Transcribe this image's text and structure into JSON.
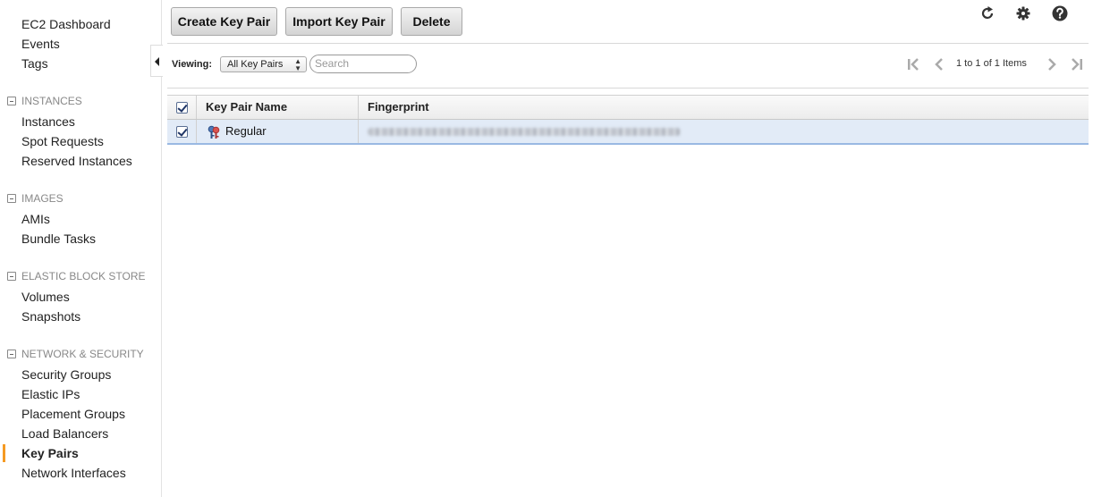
{
  "sidebar": {
    "top_items": [
      {
        "label": "EC2 Dashboard"
      },
      {
        "label": "Events"
      },
      {
        "label": "Tags"
      }
    ],
    "sections": [
      {
        "title": "INSTANCES",
        "items": [
          {
            "label": "Instances"
          },
          {
            "label": "Spot Requests"
          },
          {
            "label": "Reserved Instances"
          }
        ]
      },
      {
        "title": "IMAGES",
        "items": [
          {
            "label": "AMIs"
          },
          {
            "label": "Bundle Tasks"
          }
        ]
      },
      {
        "title": "ELASTIC BLOCK STORE",
        "items": [
          {
            "label": "Volumes"
          },
          {
            "label": "Snapshots"
          }
        ]
      },
      {
        "title": "NETWORK & SECURITY",
        "items": [
          {
            "label": "Security Groups"
          },
          {
            "label": "Elastic IPs"
          },
          {
            "label": "Placement Groups"
          },
          {
            "label": "Load Balancers"
          },
          {
            "label": "Key Pairs",
            "active": true
          },
          {
            "label": "Network Interfaces"
          }
        ]
      }
    ],
    "active_color": "#f59a23"
  },
  "toolbar": {
    "create_label": "Create Key Pair",
    "import_label": "Import Key Pair",
    "delete_label": "Delete",
    "icons": [
      "refresh-icon",
      "gear-icon",
      "help-icon"
    ]
  },
  "filter": {
    "viewing_label": "Viewing:",
    "viewing_value": "All Key Pairs",
    "search_placeholder": "Search"
  },
  "pagination": {
    "text": "1 to 1 of 1 Items"
  },
  "table": {
    "columns": [
      "Key Pair Name",
      "Fingerprint"
    ],
    "rows": [
      {
        "checked": true,
        "name": "Regular",
        "fingerprint_hidden": true
      }
    ],
    "selected_row_color": "#e2ebf7"
  }
}
